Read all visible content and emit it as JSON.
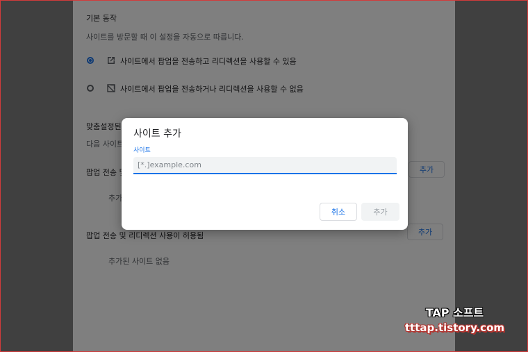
{
  "settings": {
    "section_title": "기본 동작",
    "section_desc": "사이트를 방문할 때 이 설정을 자동으로 따릅니다.",
    "option_allow": "사이트에서 팝업을 전송하고 리디렉션을 사용할 수 있음",
    "option_block": "사이트에서 팝업을 전송하거나 리디렉션을 사용할 수 없음",
    "custom_title": "맞춤설정된",
    "custom_desc": "다음 사이트",
    "blocked_heading": "팝업 전송 및",
    "blocked_empty": "추가",
    "allowed_heading": "팝업 전송 및 리디렉션 사용이 허용됨",
    "allowed_empty": "추가된 사이트 없음",
    "add_label": "추가"
  },
  "dialog": {
    "title": "사이트 추가",
    "field_label": "사이트",
    "field_placeholder": "[*.]example.com",
    "field_value": "",
    "cancel_label": "취소",
    "add_label": "추가"
  },
  "watermark": {
    "line1": "TAP 소프트",
    "line2": "tttap.tistory.com"
  },
  "colors": {
    "accent": "#1a73e8",
    "scrim": "rgba(0,0,0,0.5)"
  }
}
